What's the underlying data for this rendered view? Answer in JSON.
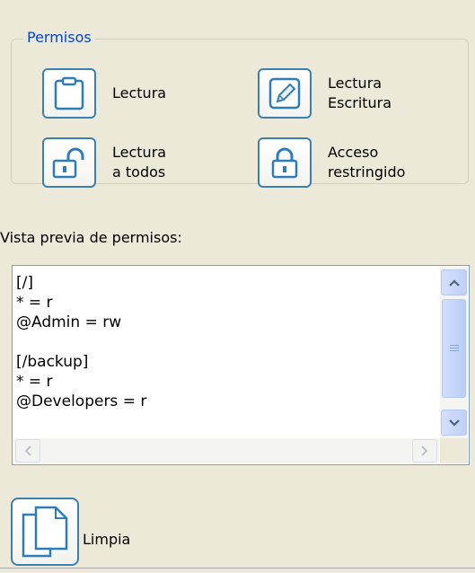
{
  "permissions": {
    "legend": "Permisos",
    "buttons": [
      {
        "label": "Lectura",
        "icon": "clipboard-icon"
      },
      {
        "label": "Lectura\nEscritura",
        "icon": "edit-pencil-icon"
      },
      {
        "label": "Lectura\na todos",
        "icon": "unlocked-padlock-icon"
      },
      {
        "label": "Acceso\nrestringido",
        "icon": "padlock-icon"
      }
    ]
  },
  "preview": {
    "label": "Vista previa de permisos:",
    "text": "[/]\n* = r\n@Admin = rw\n\n[/backup]\n* = r\n@Developers = r"
  },
  "clear": {
    "label": "Limpia",
    "icon": "documents-icon"
  },
  "colors": {
    "accent_border": "#3c7fb1",
    "legend_text": "#0046d5",
    "background": "#ece9d8"
  }
}
